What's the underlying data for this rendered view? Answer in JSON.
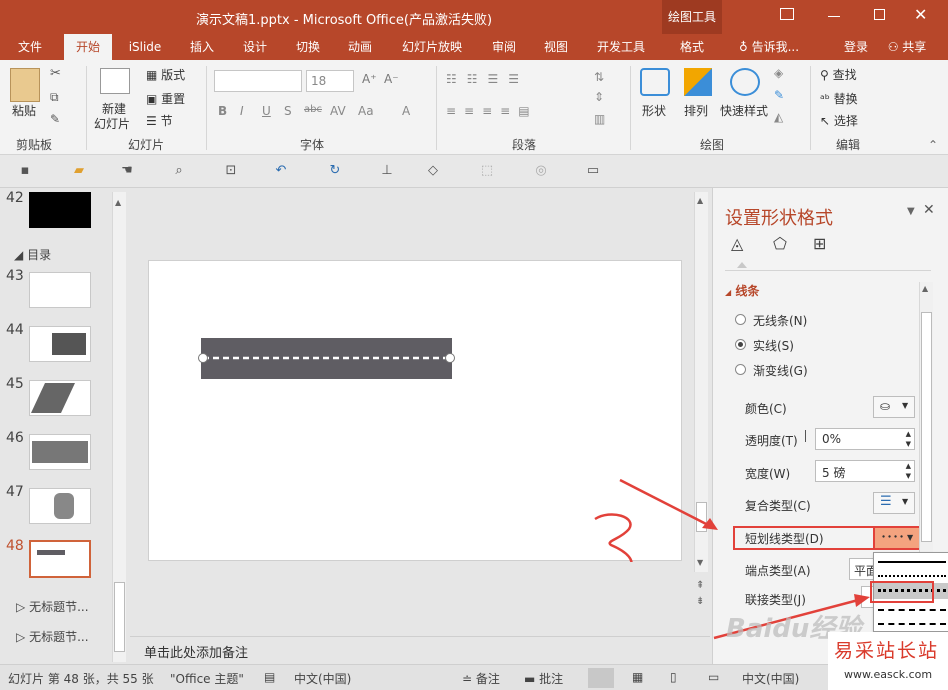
{
  "title_bar": {
    "title": "演示文稿1.pptx - Microsoft Office(产品激活失败)",
    "context_tab": "绘图工具"
  },
  "tabs": {
    "file": "文件",
    "home": "开始",
    "islide": "iSlide",
    "insert": "插入",
    "design": "设计",
    "transitions": "切换",
    "animations": "动画",
    "slideshow": "幻灯片放映",
    "review": "审阅",
    "view": "视图",
    "developer": "开发工具",
    "format": "格式",
    "tell_me": "告诉我...",
    "login": "登录",
    "share": "共享"
  },
  "ribbon": {
    "paste": "粘贴",
    "clipboard": "剪贴板",
    "new_slide_1": "新建",
    "new_slide_2": "幻灯片",
    "layout": "版式",
    "reset": "重置",
    "section": "节",
    "slides": "幻灯片",
    "font_size": "18",
    "font": "字体",
    "paragraph": "段落",
    "shape": "形状",
    "arrange": "排列",
    "quick_styles": "快速样式",
    "drawing": "绘图",
    "find": "查找",
    "replace": "替换",
    "select": "选择",
    "editing": "编辑"
  },
  "thumbnails": {
    "n42": "42",
    "section_label": "目录",
    "n43": "43",
    "n44": "44",
    "n45": "45",
    "n46": "46",
    "n47": "47",
    "n48": "48",
    "untitled1": "无标题节...",
    "untitled2": "无标题节..."
  },
  "notes_placeholder": "单击此处添加备注",
  "pane": {
    "title": "设置形状格式",
    "section": "线条",
    "no_line": "无线条(N)",
    "solid_line": "实线(S)",
    "gradient_line": "渐变线(G)",
    "color": "颜色(C)",
    "transparency": "透明度(T)",
    "transparency_value": "0%",
    "width": "宽度(W)",
    "width_value": "5 磅",
    "compound": "复合类型(C)",
    "dash": "短划线类型(D)",
    "cap": "端点类型(A)",
    "cap_value": "平面",
    "join": "联接类型(J)"
  },
  "annotation": "3",
  "status": {
    "slide_info": "幻灯片 第 48 张，共 55 张",
    "theme": "\"Office 主题\"",
    "language": "中文(中国)",
    "notes": "备注",
    "comments": "批注",
    "ime": "中文(中国)"
  },
  "watermark": {
    "logo": "Baidu经验",
    "site": "易采站长站",
    "url": "www.easck.com"
  },
  "colors": {
    "accent": "#b7472a",
    "shape_fill": "#5f5d63",
    "highlight": "#e2413a"
  }
}
